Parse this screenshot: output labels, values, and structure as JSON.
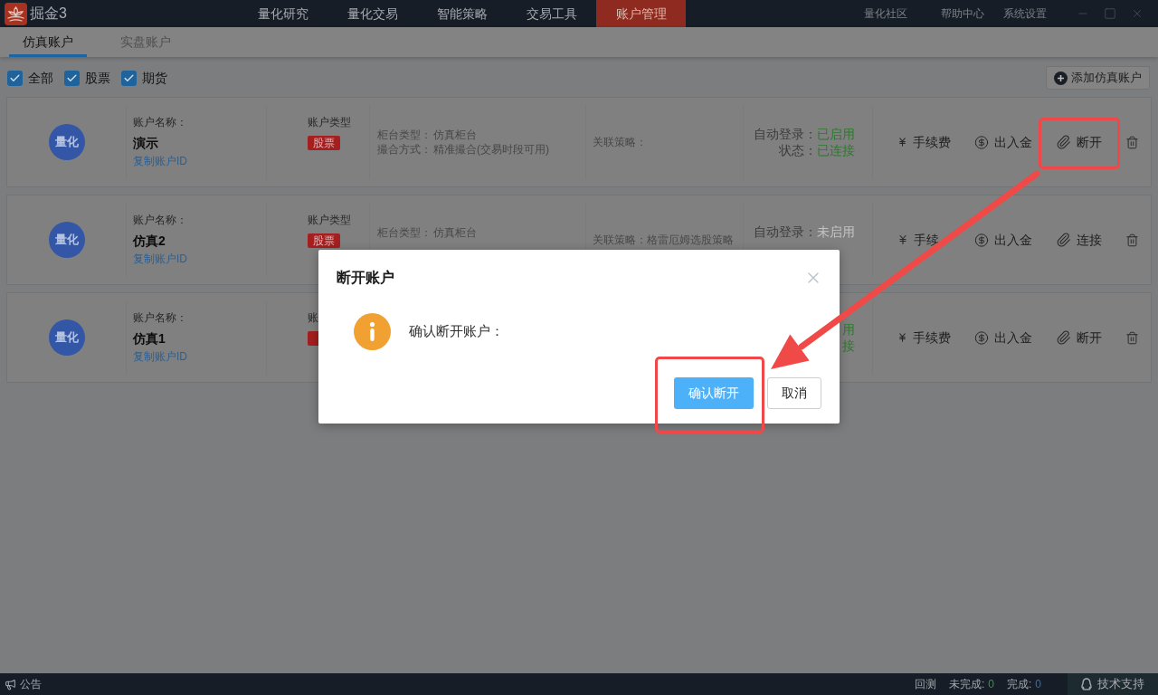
{
  "app": {
    "logo_text": "掘金3"
  },
  "nav": [
    {
      "label": "量化研究",
      "selected": false
    },
    {
      "label": "量化交易",
      "selected": false
    },
    {
      "label": "智能策略",
      "selected": false
    },
    {
      "label": "交易工具",
      "selected": false
    },
    {
      "label": "账户管理",
      "selected": true
    }
  ],
  "top_links": [
    "量化社区",
    "帮助中心",
    "系统设置"
  ],
  "sub_tabs": [
    {
      "label": "仿真账户",
      "selected": true
    },
    {
      "label": "实盘账户",
      "selected": false
    }
  ],
  "filters": [
    {
      "label": "全部",
      "checked": true
    },
    {
      "label": "股票",
      "checked": true
    },
    {
      "label": "期货",
      "checked": true
    }
  ],
  "add_button": "添加仿真账户",
  "accounts": [
    {
      "avatar": "量化",
      "name_label": "账户名称：",
      "name": "演示",
      "copy_link": "复制账户ID",
      "type_label": "账户类型",
      "type_badge": "股票",
      "counter_label": "柜台类型：",
      "counter": "仿真柜台",
      "match_label": "撮合方式：",
      "match": "精准撮合(交易时段可用)",
      "strategy_label": "关联策略：",
      "auto_login_label": "自动登录：",
      "auto_login": "已启用",
      "auto_login_on": true,
      "status_label": "状态：",
      "status": "已连接",
      "connected": true,
      "actions": [
        {
          "kind": "fee",
          "label": "手续费",
          "highlighted": false
        },
        {
          "kind": "funds",
          "label": "出入金",
          "highlighted": false
        },
        {
          "kind": "link",
          "label": "断开",
          "highlighted": true
        },
        {
          "kind": "delete",
          "highlighted": false
        }
      ]
    },
    {
      "avatar": "量化",
      "name_label": "账户名称：",
      "name": "仿真2",
      "copy_link": "复制账户ID",
      "type_label": "账户类型",
      "type_badge": "股票",
      "counter_label": "柜台类型：",
      "counter": "仿真柜台",
      "strategy_label": "关联策略：",
      "strategy": "格雷厄姆选股策略",
      "auto_login_label": "自动登录：",
      "auto_login": "未启用",
      "auto_login_on": false,
      "actions": [
        {
          "kind": "fee",
          "label": "手续",
          "highlighted": false
        },
        {
          "kind": "funds",
          "label": "出入金",
          "highlighted": false
        },
        {
          "kind": "link",
          "label": "连接",
          "highlighted": false
        },
        {
          "kind": "delete",
          "highlighted": false
        }
      ]
    },
    {
      "avatar": "量化",
      "name_label": "账户名称：",
      "name": "仿真1",
      "copy_link": "复制账户ID",
      "type_label": "账",
      "type_badge_clipped": true,
      "auto_login": "用",
      "auto_login_on": true,
      "status": "接",
      "connected": true,
      "actions": [
        {
          "kind": "fee",
          "label": "手续费",
          "highlighted": false
        },
        {
          "kind": "funds",
          "label": "出入金",
          "highlighted": false
        },
        {
          "kind": "link",
          "label": "断开",
          "highlighted": false
        },
        {
          "kind": "delete",
          "highlighted": false
        }
      ]
    }
  ],
  "dialog": {
    "title": "断开账户",
    "message": "确认断开账户：",
    "confirm": "确认断开",
    "confirm_highlighted": true,
    "cancel": "取消"
  },
  "annotation_arrow": true,
  "status_bar": {
    "notice": "公告",
    "items": [
      {
        "label": "回测"
      },
      {
        "label": "未完成:",
        "count": "0",
        "color": "#2f9a3c"
      },
      {
        "label": "完成:",
        "count": "0",
        "color": "#2e6fb8"
      }
    ],
    "support": "技术支持"
  }
}
